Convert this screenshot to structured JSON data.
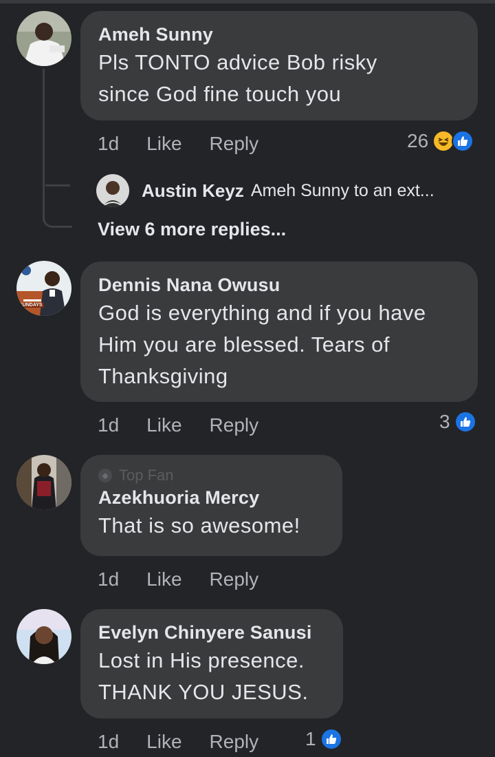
{
  "comments": [
    {
      "name": "Ameh Sunny",
      "text_lines": [
        "Pls TONTO advice Bob risky",
        "since God fine touch you"
      ],
      "time": "1d",
      "like_label": "Like",
      "reply_label": "Reply",
      "reaction_count": "26",
      "reactions": [
        "haha-icon",
        "like-icon"
      ]
    },
    {
      "name": "Dennis Nana Owusu",
      "text_lines": [
        "God is everything and if you have",
        "Him you are blessed. Tears of",
        "Thanksgiving"
      ],
      "time": "1d",
      "like_label": "Like",
      "reply_label": "Reply",
      "reaction_count": "3",
      "reactions": [
        "like-icon"
      ],
      "avatar_badge": "SUNDAYS"
    },
    {
      "badge": "Top Fan",
      "name": "Azekhuoria Mercy",
      "text_lines": [
        "That is so awesome!"
      ],
      "time": "1d",
      "like_label": "Like",
      "reply_label": "Reply"
    },
    {
      "name": "Evelyn Chinyere Sanusi",
      "text_lines": [
        "Lost in His presence.",
        "THANK YOU JESUS."
      ],
      "time": "1d",
      "like_label": "Like",
      "reply_label": "Reply",
      "reaction_count": "1",
      "reactions": [
        "like-icon"
      ]
    }
  ],
  "reply_preview": {
    "name": "Austin Keyz",
    "snippet": "Ameh Sunny to an ext..."
  },
  "view_more": "View 6 more replies...",
  "colors": {
    "background": "#232427",
    "bubble": "#3a3b3c",
    "text": "#e4e6eb",
    "secondary_text": "#b0b3b8",
    "like_blue": "#1b74e4",
    "haha_yellow": "#f7b928"
  }
}
